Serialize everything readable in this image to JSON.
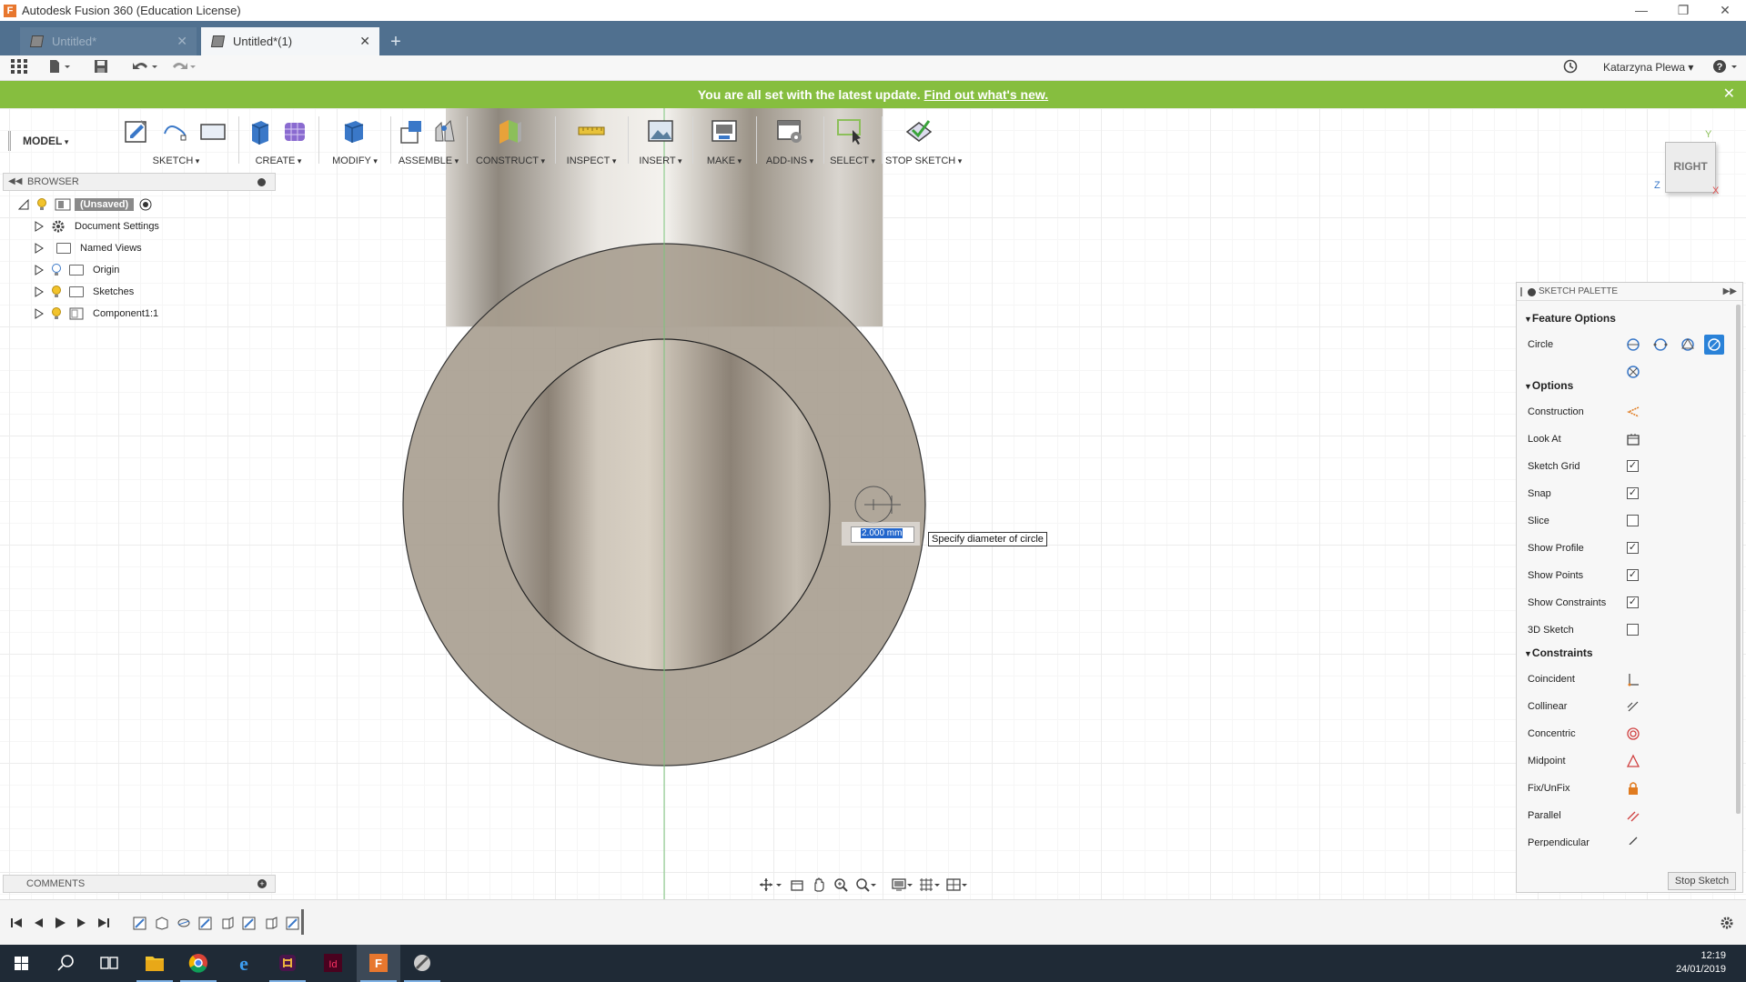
{
  "window": {
    "title": "Autodesk Fusion 360 (Education License)",
    "logo_letter": "F"
  },
  "tabs": [
    {
      "label": "Untitled*"
    },
    {
      "label": "Untitled*(1)"
    }
  ],
  "user": {
    "name": "Katarzyna Plewa"
  },
  "banner": {
    "text": "You are all set with the latest update.",
    "link": "Find out what's new."
  },
  "toolbar": {
    "workspace": "MODEL",
    "groups": [
      "SKETCH",
      "CREATE",
      "MODIFY",
      "ASSEMBLE",
      "CONSTRUCT",
      "INSPECT",
      "INSERT",
      "MAKE",
      "ADD-INS",
      "SELECT",
      "STOP SKETCH"
    ]
  },
  "browser": {
    "title": "BROWSER",
    "root": "(Unsaved)",
    "items": [
      "Document Settings",
      "Named Views",
      "Origin",
      "Sketches",
      "Component1:1"
    ]
  },
  "comments": {
    "title": "COMMENTS"
  },
  "viewcube": {
    "face": "RIGHT",
    "axis_z": "Z",
    "axis_x": "X",
    "axis_y": "Y"
  },
  "sketch_input": {
    "value": "2.000 mm",
    "tooltip": "Specify diameter of circle"
  },
  "palette": {
    "title": "SKETCH PALETTE",
    "sections": {
      "feature_options": "Feature Options",
      "options": "Options",
      "constraints": "Constraints"
    },
    "circle_label": "Circle",
    "options": [
      {
        "label": "Construction"
      },
      {
        "label": "Look At"
      },
      {
        "label": "Sketch Grid",
        "checked": true
      },
      {
        "label": "Snap",
        "checked": true
      },
      {
        "label": "Slice",
        "checked": false
      },
      {
        "label": "Show Profile",
        "checked": true
      },
      {
        "label": "Show Points",
        "checked": true
      },
      {
        "label": "Show Constraints",
        "checked": true
      },
      {
        "label": "3D Sketch",
        "checked": false
      }
    ],
    "constraints": [
      "Coincident",
      "Collinear",
      "Concentric",
      "Midpoint",
      "Fix/UnFix",
      "Parallel",
      "Perpendicular"
    ],
    "stop_button": "Stop Sketch"
  },
  "clock": {
    "time": "12:19",
    "date": "24/01/2019"
  },
  "colors": {
    "tabbar": "#50708f",
    "banner": "#86be3f",
    "model_fill": "#a79d8f",
    "accent_blue": "#2266cc",
    "taskbar": "#1f2a36"
  }
}
